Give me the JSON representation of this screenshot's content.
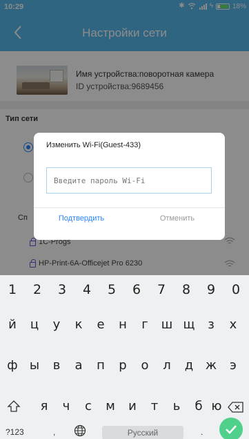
{
  "status_bar": {
    "time": "10:29",
    "battery": "18%"
  },
  "header": {
    "title": "Настройки сети"
  },
  "device": {
    "name_text": "Имя устройства:поворотная камера",
    "id_text": "ID устройства:9689456"
  },
  "network": {
    "type_label": "Тип сети",
    "list_header": "Сп",
    "wifi_items": [
      "1C-Progs",
      "HP-Print-6A-Officejet Pro 6230"
    ]
  },
  "dialog": {
    "title": "Изменить Wi-Fi(Guest-433)",
    "password_placeholder": "Введите пароль Wi-Fi",
    "confirm_label": "Подтвердить",
    "cancel_label": "Отменить"
  },
  "keyboard": {
    "numbers": [
      "1",
      "2",
      "3",
      "4",
      "5",
      "6",
      "7",
      "8",
      "9",
      "0"
    ],
    "row1": [
      "й",
      "ц",
      "у",
      "к",
      "е",
      "н",
      "г",
      "ш",
      "щ",
      "з",
      "х"
    ],
    "row2": [
      "ф",
      "ы",
      "в",
      "а",
      "п",
      "р",
      "о",
      "л",
      "д",
      "ж",
      "э"
    ],
    "row3": [
      "я",
      "ч",
      "с",
      "м",
      "и",
      "т",
      "ь",
      "б",
      "ю"
    ],
    "symbols_key": "?123",
    "comma_key": ",",
    "space_label": "Русский",
    "period_key": "."
  },
  "colors": {
    "accent": "#58b8ec",
    "link": "#2b84ff",
    "enter": "#4fd18b"
  }
}
